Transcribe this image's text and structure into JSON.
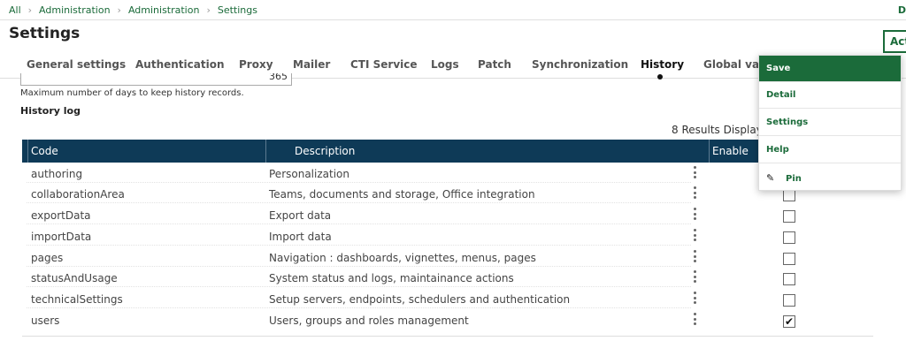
{
  "breadcrumb": [
    "All",
    "Administration",
    "Administration",
    "Settings"
  ],
  "top_right_letter": "D",
  "page": {
    "title": "Settings"
  },
  "action_button": "Act",
  "tabs": [
    {
      "label": "General settings"
    },
    {
      "label": "Authentication"
    },
    {
      "label": "Proxy"
    },
    {
      "label": "Mailer"
    },
    {
      "label": "CTI Service"
    },
    {
      "label": "Logs"
    },
    {
      "label": "Patch"
    },
    {
      "label": "Synchronization"
    },
    {
      "label": "History",
      "active": true
    },
    {
      "label": "Global vari"
    }
  ],
  "days_field": {
    "value": "365",
    "help": "Maximum number of days to keep history records."
  },
  "history_log": {
    "title": "History log",
    "results": "8 Results  Display",
    "columns": [
      "Code",
      "Description",
      "Enable"
    ],
    "rows": [
      {
        "code": "authoring",
        "description": "Personalization",
        "enabled": null
      },
      {
        "code": "collaborationArea",
        "description": "Teams, documents and storage, Office integration",
        "enabled": false
      },
      {
        "code": "exportData",
        "description": "Export data",
        "enabled": false
      },
      {
        "code": "importData",
        "description": "Import data",
        "enabled": false
      },
      {
        "code": "pages",
        "description": "Navigation : dashboards, vignettes, menus, pages",
        "enabled": false
      },
      {
        "code": "statusAndUsage",
        "description": "System status and logs, maintainance actions",
        "enabled": false
      },
      {
        "code": "technicalSettings",
        "description": "Setup servers, endpoints, schedulers and authentication",
        "enabled": false
      },
      {
        "code": "users",
        "description": "Users, groups and roles management",
        "enabled": true
      }
    ]
  },
  "dropdown_menu": {
    "items": [
      {
        "label": "Save",
        "primary": true
      },
      {
        "label": "Detail"
      },
      {
        "label": "Settings"
      },
      {
        "label": "Help"
      },
      {
        "label": "Pin",
        "icon": "pin-icon"
      }
    ]
  },
  "colors": {
    "accent": "#1b6b3a",
    "table_header": "#0e3a57"
  },
  "check_glyph": "✔"
}
